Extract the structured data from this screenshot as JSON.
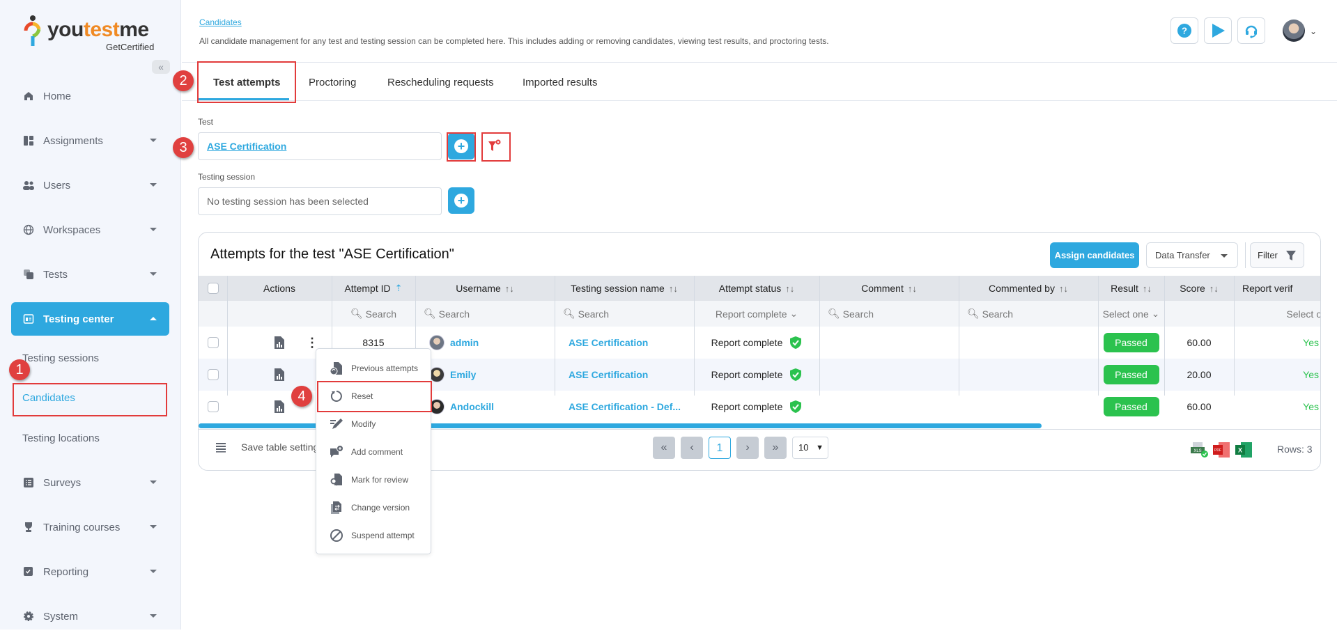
{
  "brand": {
    "name_you": "you",
    "name_test": "test",
    "name_me": "me",
    "tagline": "GetCertified"
  },
  "sidebar": {
    "collapse_icon": "«",
    "items": [
      {
        "label": "Home",
        "icon": "home-icon"
      },
      {
        "label": "Assignments",
        "icon": "assignments-icon"
      },
      {
        "label": "Users",
        "icon": "users-icon"
      },
      {
        "label": "Workspaces",
        "icon": "globe-icon"
      },
      {
        "label": "Tests",
        "icon": "tests-icon"
      },
      {
        "label": "Testing center",
        "icon": "calendar-icon",
        "active": true
      },
      {
        "label": "Surveys",
        "icon": "list-icon"
      },
      {
        "label": "Training courses",
        "icon": "trophy-icon"
      },
      {
        "label": "Reporting",
        "icon": "report-icon"
      },
      {
        "label": "System",
        "icon": "gear-icon"
      }
    ],
    "sub_items": [
      {
        "label": "Testing sessions"
      },
      {
        "label": "Candidates",
        "selected": true
      },
      {
        "label": "Testing locations"
      }
    ]
  },
  "header": {
    "breadcrumb": "Candidates",
    "description": "All candidate management for any test and testing session can be completed here. This includes adding or removing candidates, viewing test results, and proctoring tests.",
    "icons": [
      "help-icon",
      "play-icon",
      "headset-icon"
    ],
    "user_caret": "⌄"
  },
  "tabs": [
    {
      "label": "Test attempts",
      "active": true
    },
    {
      "label": "Proctoring"
    },
    {
      "label": "Rescheduling requests"
    },
    {
      "label": "Imported results"
    }
  ],
  "form": {
    "test_label": "Test",
    "test_value": "ASE Certification",
    "session_label": "Testing session",
    "session_placeholder": "No testing session has been selected"
  },
  "annotations": [
    "1",
    "2",
    "3",
    "4"
  ],
  "table": {
    "title": "Attempts for the test \"ASE Certification\"",
    "assign_label": "Assign candidates",
    "data_transfer_label": "Data Transfer",
    "filter_label": "Filter",
    "columns": [
      {
        "label": "Actions"
      },
      {
        "label": "Attempt ID",
        "sort": "⇡"
      },
      {
        "label": "Username",
        "sort": "↑↓"
      },
      {
        "label": "Testing session name",
        "sort": "↑↓"
      },
      {
        "label": "Attempt status",
        "sort": "↑↓"
      },
      {
        "label": "Comment",
        "sort": "↑↓"
      },
      {
        "label": "Commented by",
        "sort": "↑↓"
      },
      {
        "label": "Result",
        "sort": "↑↓"
      },
      {
        "label": "Score",
        "sort": "↑↓"
      },
      {
        "label": "Report verif"
      }
    ],
    "filters": {
      "search": "Search",
      "status_selected": "Report complete",
      "result_selected": "Select one",
      "verified_selected": "Select o"
    },
    "rows": [
      {
        "id": "8315",
        "username": "admin",
        "session": "ASE Certification",
        "status": "Report complete",
        "result": "Passed",
        "score": "60.00",
        "verified": "Yes"
      },
      {
        "id": "",
        "username": "Emily",
        "session": "ASE Certification",
        "status": "Report complete",
        "result": "Passed",
        "score": "20.00",
        "verified": "Yes"
      },
      {
        "id": "",
        "username": "Andockill",
        "session": "ASE Certification - Def...",
        "status": "Report complete",
        "result": "Passed",
        "score": "60.00",
        "verified": "Yes"
      }
    ],
    "footer": {
      "save_settings": "Save table settings",
      "page_first": "«",
      "page_prev": "‹",
      "page_current": "1",
      "page_next": "›",
      "page_last": "»",
      "page_size": "10",
      "rows_label": "Rows: 3"
    }
  },
  "context_menu": {
    "items": [
      {
        "label": "Previous attempts"
      },
      {
        "label": "Reset",
        "highlighted": true
      },
      {
        "label": "Modify"
      },
      {
        "label": "Add comment"
      },
      {
        "label": "Mark for review"
      },
      {
        "label": "Change version"
      },
      {
        "label": "Suspend attempt"
      }
    ]
  },
  "colors": {
    "accent": "#2ea8df",
    "success": "#2bc24e",
    "annotation": "#e0403f"
  }
}
